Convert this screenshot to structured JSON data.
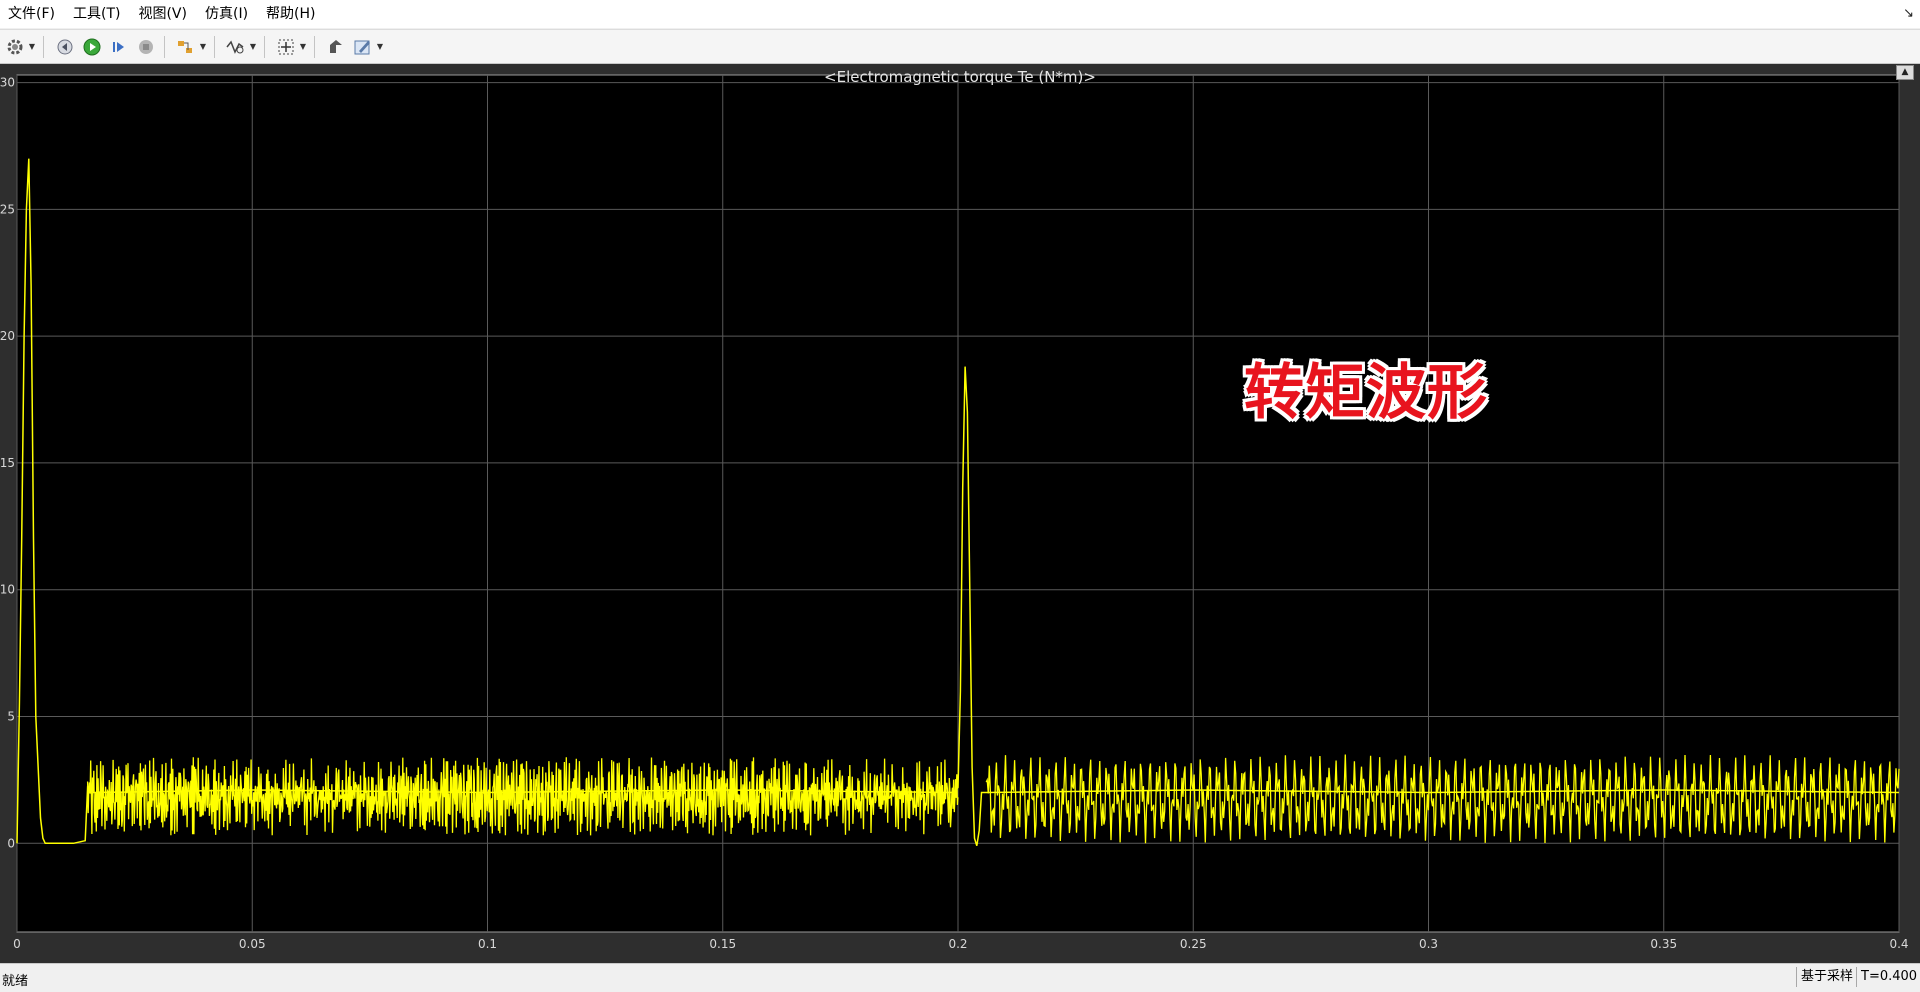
{
  "menu": [
    "文件(F)",
    "工具(T)",
    "视图(V)",
    "仿真(I)",
    "帮助(H)"
  ],
  "toolbar": {
    "icons": [
      "gear-icon",
      "rewind-icon",
      "run-icon",
      "step-forward-icon",
      "stop-icon",
      "highlight-icon",
      "signal-selector-icon",
      "zoom-fit-icon",
      "parameters-icon",
      "style-icon"
    ]
  },
  "plot": {
    "title": "<Electromagnetic torque Te (N*m)>",
    "background": "#000000",
    "line_color": "#ffff00",
    "grid_color": "#5a5a5a",
    "overlay_caption": "转矩波形",
    "overlay_color": "#e8141e"
  },
  "chart_data": {
    "type": "line",
    "title": "<Electromagnetic torque Te (N*m)>",
    "xlabel": "",
    "ylabel": "",
    "xlim": [
      0,
      0.4
    ],
    "ylim": [
      -3.5,
      30.3
    ],
    "grid": true,
    "xticks": [
      "0",
      "0.05",
      "0.1",
      "0.15",
      "0.2",
      "0.25",
      "0.3",
      "0.35",
      "0.4"
    ],
    "yticks": [
      "0",
      "5",
      "10",
      "15",
      "20",
      "25",
      "30"
    ],
    "series": [
      {
        "color": "#ffff00",
        "x": [
          0,
          0.0005,
          0.001,
          0.0015,
          0.002,
          0.0025,
          0.003,
          0.0035,
          0.004,
          0.005,
          0.0055,
          0.006,
          0.008,
          0.01,
          0.012,
          0.0145,
          0.015,
          0.016,
          0.05,
          0.1,
          0.15,
          0.199,
          0.2,
          0.2005,
          0.201,
          0.2015,
          0.202,
          0.2025,
          0.203,
          0.2035,
          0.204,
          0.2045,
          0.205,
          0.206,
          0.25,
          0.3,
          0.35,
          0.4
        ],
        "y": [
          0,
          5.5,
          12,
          20,
          25,
          27,
          22,
          12,
          5,
          1,
          0.2,
          0,
          0,
          0,
          0,
          0.1,
          2.2,
          2.0,
          2.1,
          2.0,
          2.1,
          2.0,
          2.2,
          6,
          14,
          18.8,
          17,
          10,
          3,
          0.2,
          -0.1,
          0.5,
          2.0,
          2.0,
          2.1,
          2.0,
          2.1,
          2.0
        ],
        "ripple_band": {
          "segment_1": {
            "x_range": [
              0.015,
              0.2
            ],
            "min": 0.3,
            "max": 3.4
          },
          "segment_2": {
            "x_range": [
              0.206,
              0.4
            ],
            "min": 0.0,
            "max": 3.5
          }
        }
      }
    ]
  },
  "status": {
    "text": "就绪",
    "mode": "基于采样",
    "time": "T=0.400"
  }
}
